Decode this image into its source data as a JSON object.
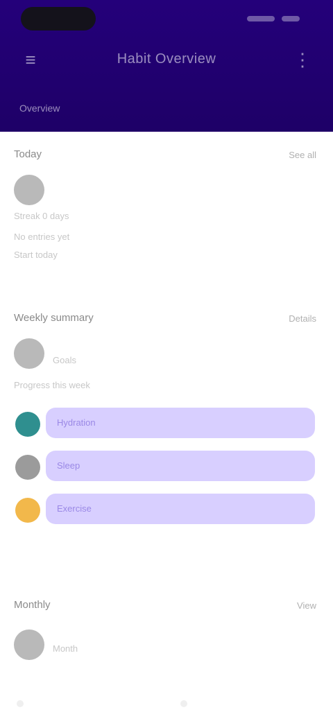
{
  "header": {
    "title": "Habit Overview",
    "subtitle": "Overview",
    "left_icon": "menu-icon",
    "right_icon": "more-icon"
  },
  "sections": [
    {
      "title": "Today",
      "link": "See all",
      "lines": [
        "Streak 0 days",
        "No entries yet",
        "Start today"
      ]
    },
    {
      "title": "Weekly summary",
      "link": "Details",
      "meta": "Goals",
      "meta2": "Progress this week",
      "bars": [
        {
          "label": "Hydration",
          "color": "#2f8f8f"
        },
        {
          "label": "Sleep",
          "color": "#9b9b9b"
        },
        {
          "label": "Exercise",
          "color": "#f2b84b"
        }
      ]
    },
    {
      "title": "Monthly",
      "link": "View",
      "meta": "Month"
    }
  ]
}
